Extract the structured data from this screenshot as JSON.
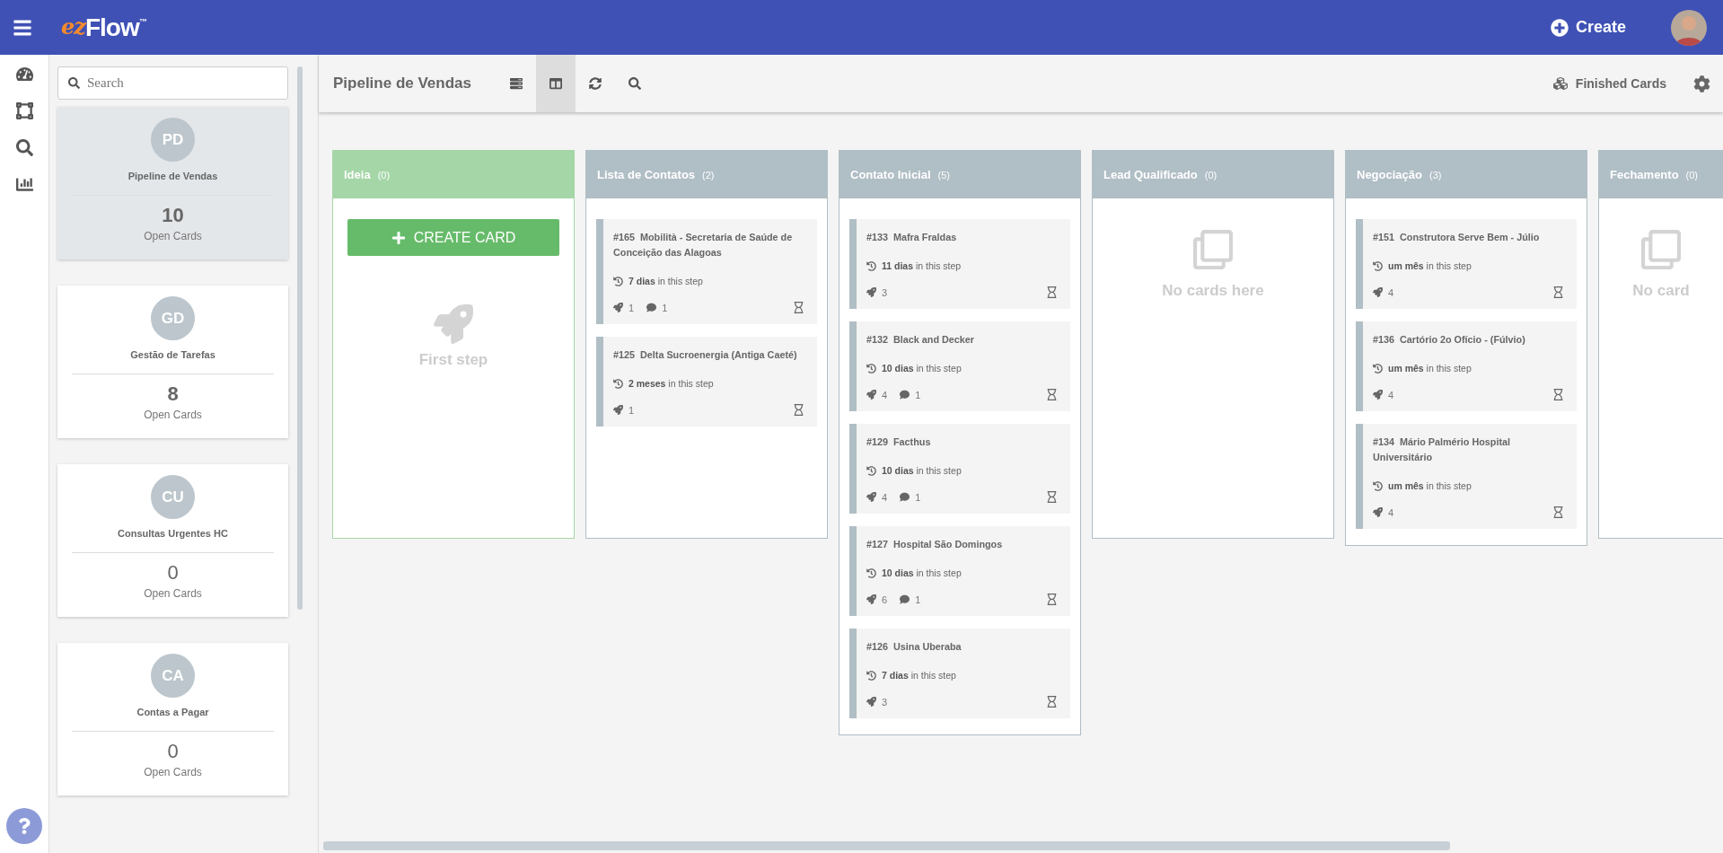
{
  "topbar": {
    "logo": {
      "prefix": "ez",
      "name": "Flow",
      "mark": "™"
    },
    "create_label": "Create"
  },
  "sidebar": {
    "search": {
      "placeholder": "Search"
    },
    "pipelines": [
      {
        "initials": "PD",
        "name": "Pipeline de Vendas",
        "count": "10",
        "count_label": "Open Cards",
        "bold": true,
        "selected": true
      },
      {
        "initials": "GD",
        "name": "Gestão de Tarefas",
        "count": "8",
        "count_label": "Open Cards",
        "bold": true,
        "selected": false
      },
      {
        "initials": "CU",
        "name": "Consultas Urgentes HC",
        "count": "0",
        "count_label": "Open Cards",
        "bold": false,
        "selected": false
      },
      {
        "initials": "CA",
        "name": "Contas a Pagar",
        "count": "0",
        "count_label": "Open Cards",
        "bold": false,
        "selected": false
      }
    ]
  },
  "board": {
    "title": "Pipeline de Vendas",
    "views": [
      {
        "kind": "list",
        "selected": false
      },
      {
        "kind": "columns",
        "selected": true
      }
    ],
    "finished_label": "Finished Cards",
    "columns": [
      {
        "name": "Ideia",
        "count": "(0)",
        "color": "#a5d6a7",
        "kind": "first",
        "action": "CREATE CARD",
        "hint": "First step"
      },
      {
        "name": "Lista de Contatos",
        "count": "(2)",
        "color": "#b0bec5",
        "kind": "cards",
        "cards": [
          {
            "title": "#165  Mobilità - Secretaria de Saúde de Conceição das Alagoas",
            "age": "**7 dias** in this step",
            "tasks": "1",
            "comments": "1"
          },
          {
            "title": "#125  Delta Sucroenergia (Antiga Caeté)",
            "age": "**2 meses** in this step",
            "tasks": "1"
          }
        ]
      },
      {
        "name": "Contato Inicial",
        "count": "(5)",
        "color": "#b0bec5",
        "kind": "cards",
        "cards": [
          {
            "title": "#133  Mafra Fraldas",
            "age": "**11 dias** in this step",
            "tasks": "3"
          },
          {
            "title": "#132  Black and Decker",
            "age": "**10 dias** in this step",
            "tasks": "4",
            "comments": "1"
          },
          {
            "title": "#129  Facthus",
            "age": "**10 dias** in this step",
            "tasks": "4",
            "comments": "1"
          },
          {
            "title": "#127  Hospital São Domingos",
            "age": "**10 dias** in this step",
            "tasks": "6",
            "comments": "1"
          },
          {
            "title": "#126  Usina Uberaba",
            "age": "**7 dias** in this step",
            "tasks": "3"
          }
        ]
      },
      {
        "name": "Lead Qualificado",
        "count": "(0)",
        "color": "#b0bec5",
        "kind": "empty",
        "hint": "No cards here"
      },
      {
        "name": "Negociação",
        "count": "(3)",
        "color": "#b0bec5",
        "kind": "cards",
        "cards": [
          {
            "title": "#151  Construtora Serve Bem - Júlio",
            "age": "**um mês** in this step",
            "tasks": "4"
          },
          {
            "title": "#136  Cartório 2o Ofício - (Fúlvio)",
            "age": "**um mês** in this step",
            "tasks": "4"
          },
          {
            "title": "#134  Mário Palmério Hospital Universitário",
            "age": "**um mês** in this step",
            "tasks": "4"
          }
        ]
      },
      {
        "name": "Fechamento",
        "count": "(0)",
        "color": "#b0bec5",
        "kind": "empty",
        "hint": "No card"
      }
    ]
  }
}
